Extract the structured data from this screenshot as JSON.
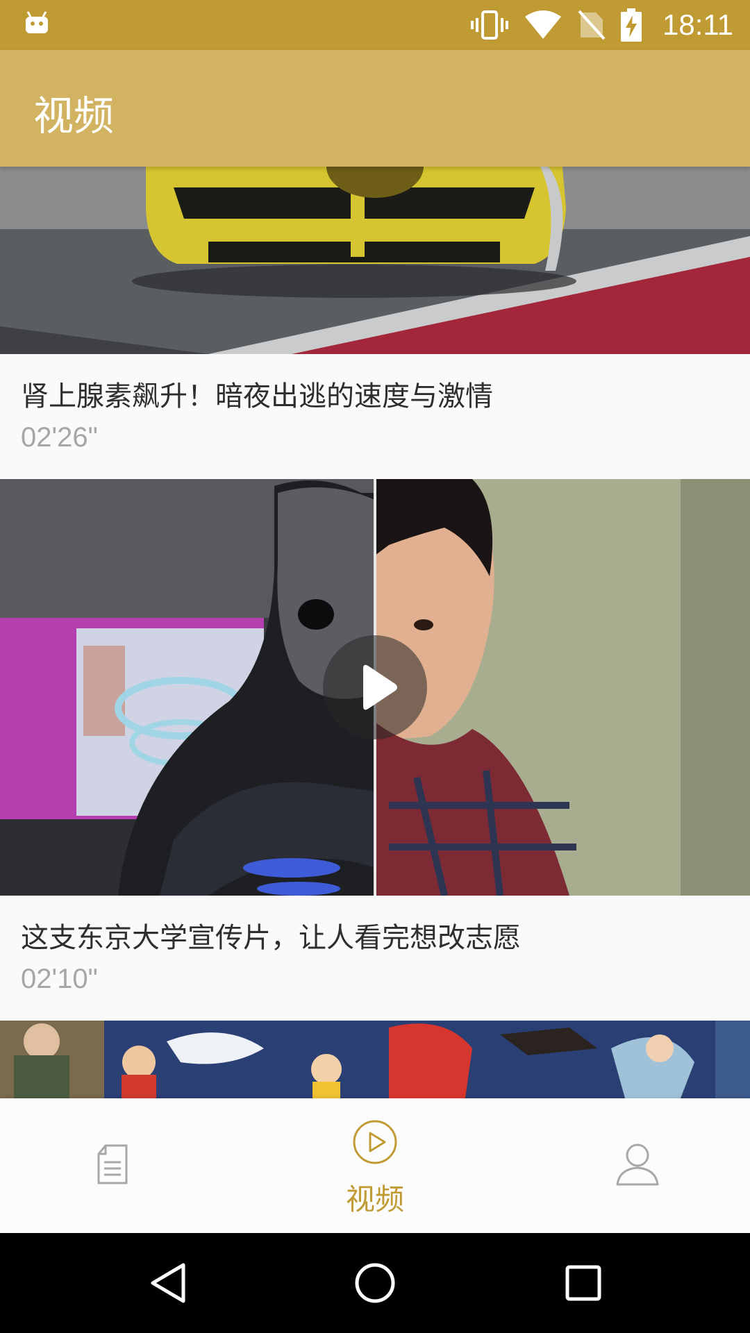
{
  "status_bar": {
    "time": "18:11",
    "icons": [
      "android-debug-icon",
      "vibrate-icon",
      "wifi-icon",
      "no-sim-icon",
      "battery-charging-icon"
    ]
  },
  "app_bar": {
    "title": "视频"
  },
  "videos": [
    {
      "title": "肾上腺素飙升！暗夜出逃的速度与激情",
      "duration": "02'26\""
    },
    {
      "title": "这支东京大学宣传片，让人看完想改志愿",
      "duration": "02'10\""
    },
    {
      "title": "",
      "duration": ""
    }
  ],
  "bottom_nav": {
    "items": [
      {
        "icon": "article-icon",
        "label": ""
      },
      {
        "icon": "play-circle-icon",
        "label": "视频",
        "active": true
      },
      {
        "icon": "person-icon",
        "label": ""
      }
    ],
    "active_color": "#c09b34",
    "inactive_color": "#a8a8a8"
  },
  "system_nav": {
    "icons": [
      "back-icon",
      "home-icon",
      "recents-icon"
    ]
  },
  "colors": {
    "status_bar": "#c09b34",
    "app_bar": "#d1b362"
  }
}
